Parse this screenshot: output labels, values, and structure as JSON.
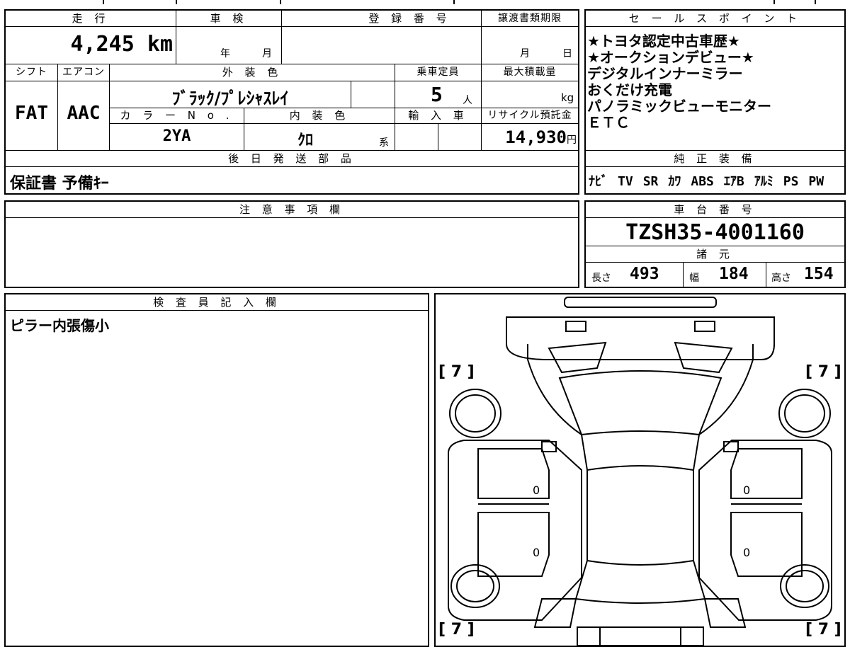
{
  "main_table": {
    "mileage_label": "走 行",
    "mileage_value": "4,245",
    "mileage_unit": "km",
    "shaken_label": "車 検",
    "shaken_year": "年",
    "shaken_month": "月",
    "registration_label": "登 録 番 号",
    "transfer_label": "譲渡書類期限",
    "transfer_month": "月",
    "transfer_day": "日",
    "shift_label": "シフト",
    "shift_value": "FAT",
    "aircon_label": "エアコン",
    "aircon_value": "AAC",
    "exterior_label": "外 装 色",
    "exterior_value": "ﾌﾞﾗｯｸ/ﾌﾟﾚｼｬｽﾚｲ",
    "capacity_label": "乗車定員",
    "capacity_value": "5",
    "capacity_unit": "人",
    "maxload_label": "最大積載量",
    "maxload_unit": "kg",
    "color_no_label": "カ ラ ー N o .",
    "color_no_value": "2YA",
    "interior_label": "内 装 色",
    "interior_value": "ｸﾛ",
    "interior_suffix": "系",
    "import_label": "輸 入 車",
    "recycle_label": "リサイクル預託金",
    "recycle_value": "14,930",
    "recycle_unit": "円",
    "later_parts_label": "後 日 発 送 部 品",
    "later_parts_value": "保証書 予備ｷｰ"
  },
  "sales_points": {
    "label": "セ ー ル ス ポ イ ン ト",
    "items": [
      "★トヨタ認定中古車歴★",
      "★オークションデビュー★",
      "デジタルインナーミラー",
      "おくだけ充電",
      "パノラミックビューモニター",
      "ＥＴＣ"
    ]
  },
  "genuine_equipment": {
    "label": "純 正 装 備",
    "items": [
      "ﾅﾋﾞ",
      "TV",
      "SR",
      "ｶﾜ",
      "ABS",
      "ｴｱB",
      "ｱﾙﾐ",
      "PS",
      "PW"
    ]
  },
  "notes": {
    "label": "注 意 事 項 欄",
    "value": ""
  },
  "chassis": {
    "label": "車 台 番 号",
    "value": "TZSH35-4001160",
    "specs_label": "諸 元",
    "length_label": "長さ",
    "length_value": "493",
    "width_label": "幅",
    "width_value": "184",
    "height_label": "高さ",
    "height_value": "154"
  },
  "inspector": {
    "label": "検 査 員 記 入 欄",
    "value": "ピラー内張傷小"
  },
  "diagram": {
    "tire_front_left": "[ 7 ]",
    "tire_front_right": "[ 7 ]",
    "tire_rear_left": "[ 7 ]",
    "tire_rear_right": "[ 7 ]",
    "door_mark_fl": "0",
    "door_mark_fr": "0",
    "door_mark_rl": "0",
    "door_mark_rr": "0"
  }
}
